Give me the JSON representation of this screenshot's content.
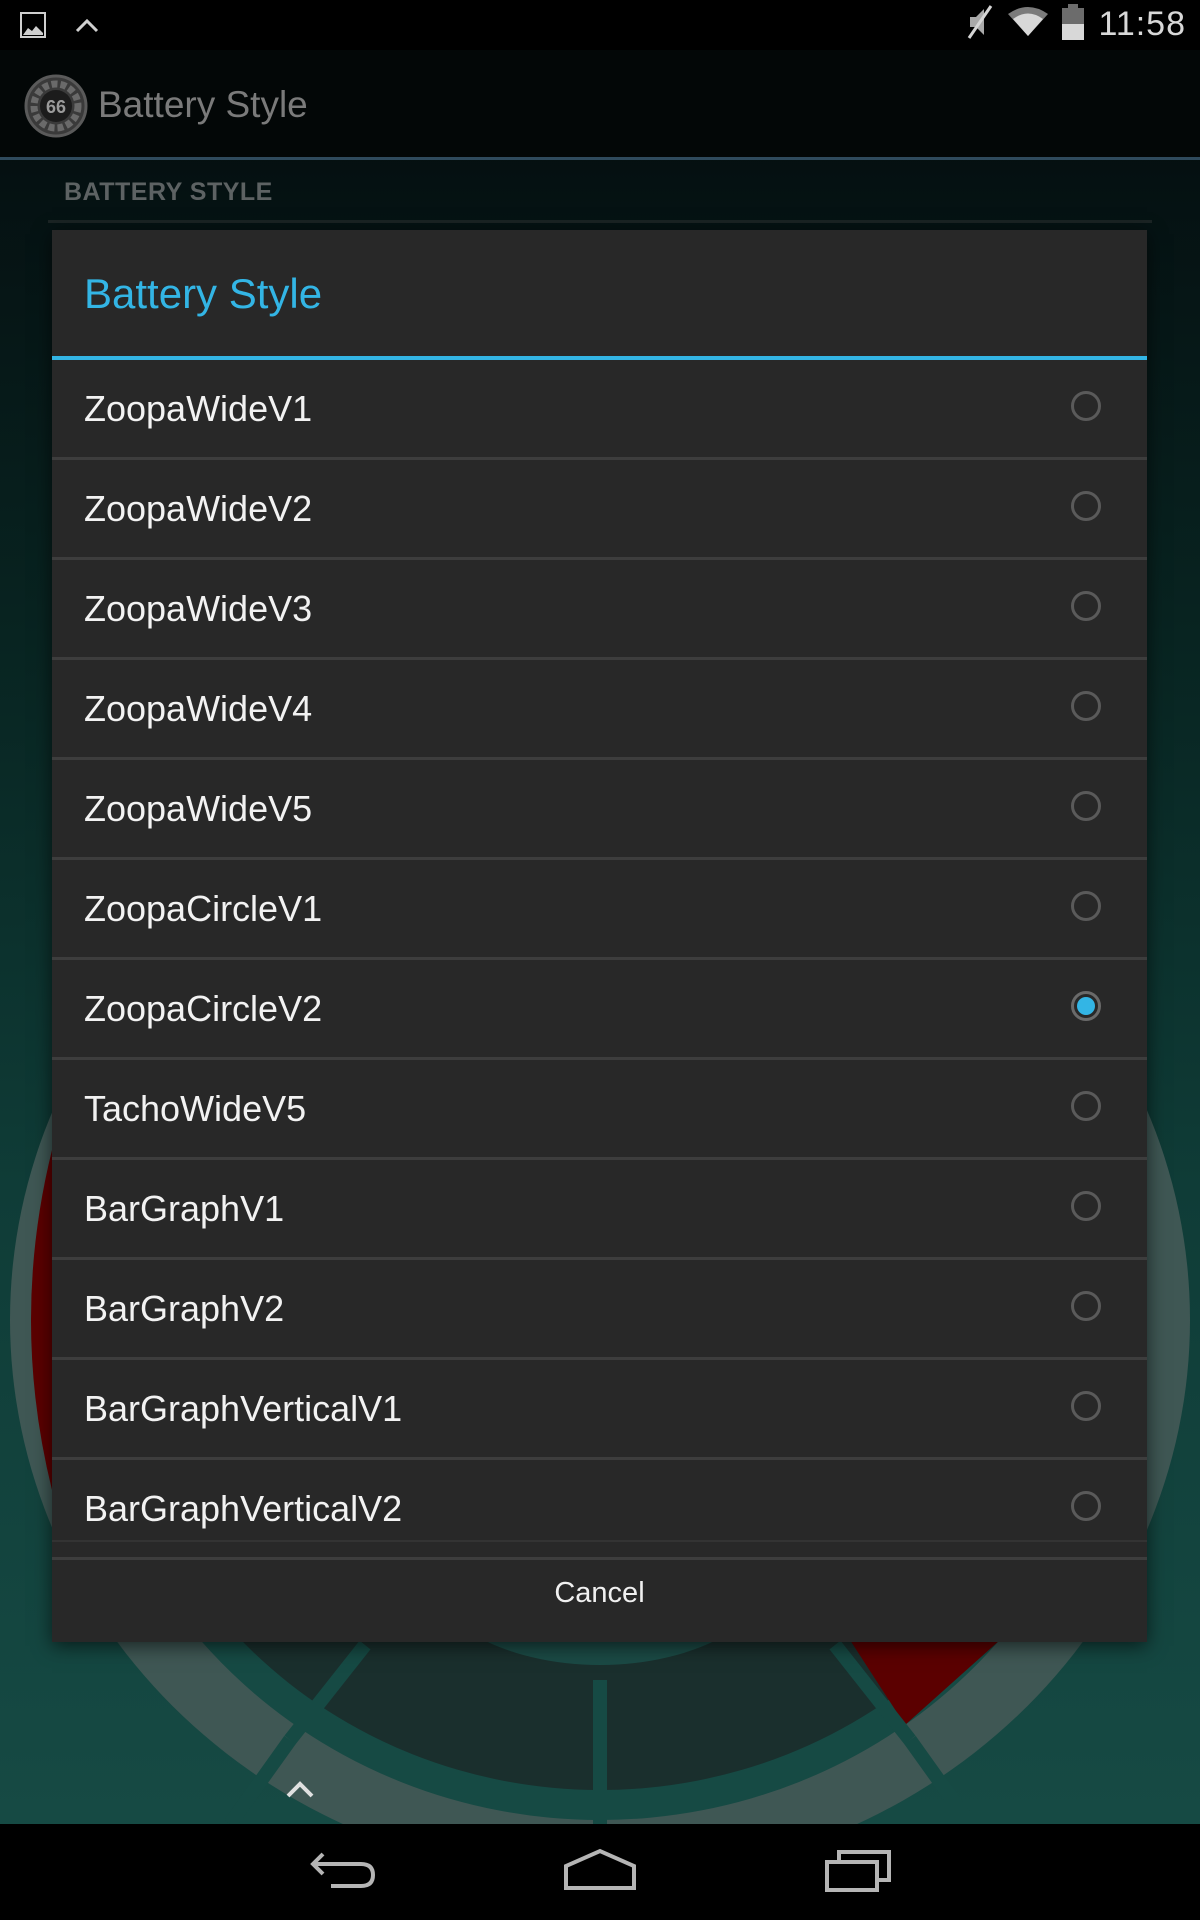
{
  "status_bar": {
    "time": "11:58",
    "left_icons": [
      "gallery-notification-icon",
      "chevron-up-icon"
    ],
    "right_icons": [
      "mute-icon",
      "wifi-icon",
      "battery-icon"
    ]
  },
  "action_bar": {
    "app_icon_value": "66",
    "title": "Battery Style"
  },
  "section_header": "BATTERY STYLE",
  "dialog": {
    "title": "Battery Style",
    "accent_color": "#33b5e5",
    "selected": "ZoopaCircleV2",
    "options": [
      {
        "label": "ZoopaWideV1",
        "checked": false
      },
      {
        "label": "ZoopaWideV2",
        "checked": false
      },
      {
        "label": "ZoopaWideV3",
        "checked": false
      },
      {
        "label": "ZoopaWideV4",
        "checked": false
      },
      {
        "label": "ZoopaWideV5",
        "checked": false
      },
      {
        "label": "ZoopaCircleV1",
        "checked": false
      },
      {
        "label": "ZoopaCircleV2",
        "checked": true
      },
      {
        "label": "TachoWideV5",
        "checked": false
      },
      {
        "label": "BarGraphV1",
        "checked": false
      },
      {
        "label": "BarGraphV2",
        "checked": false
      },
      {
        "label": "BarGraphVerticalV1",
        "checked": false
      },
      {
        "label": "BarGraphVerticalV2",
        "checked": false
      }
    ],
    "cancel_label": "Cancel"
  },
  "nav_bar": {
    "buttons": [
      "back",
      "home",
      "recents"
    ]
  }
}
